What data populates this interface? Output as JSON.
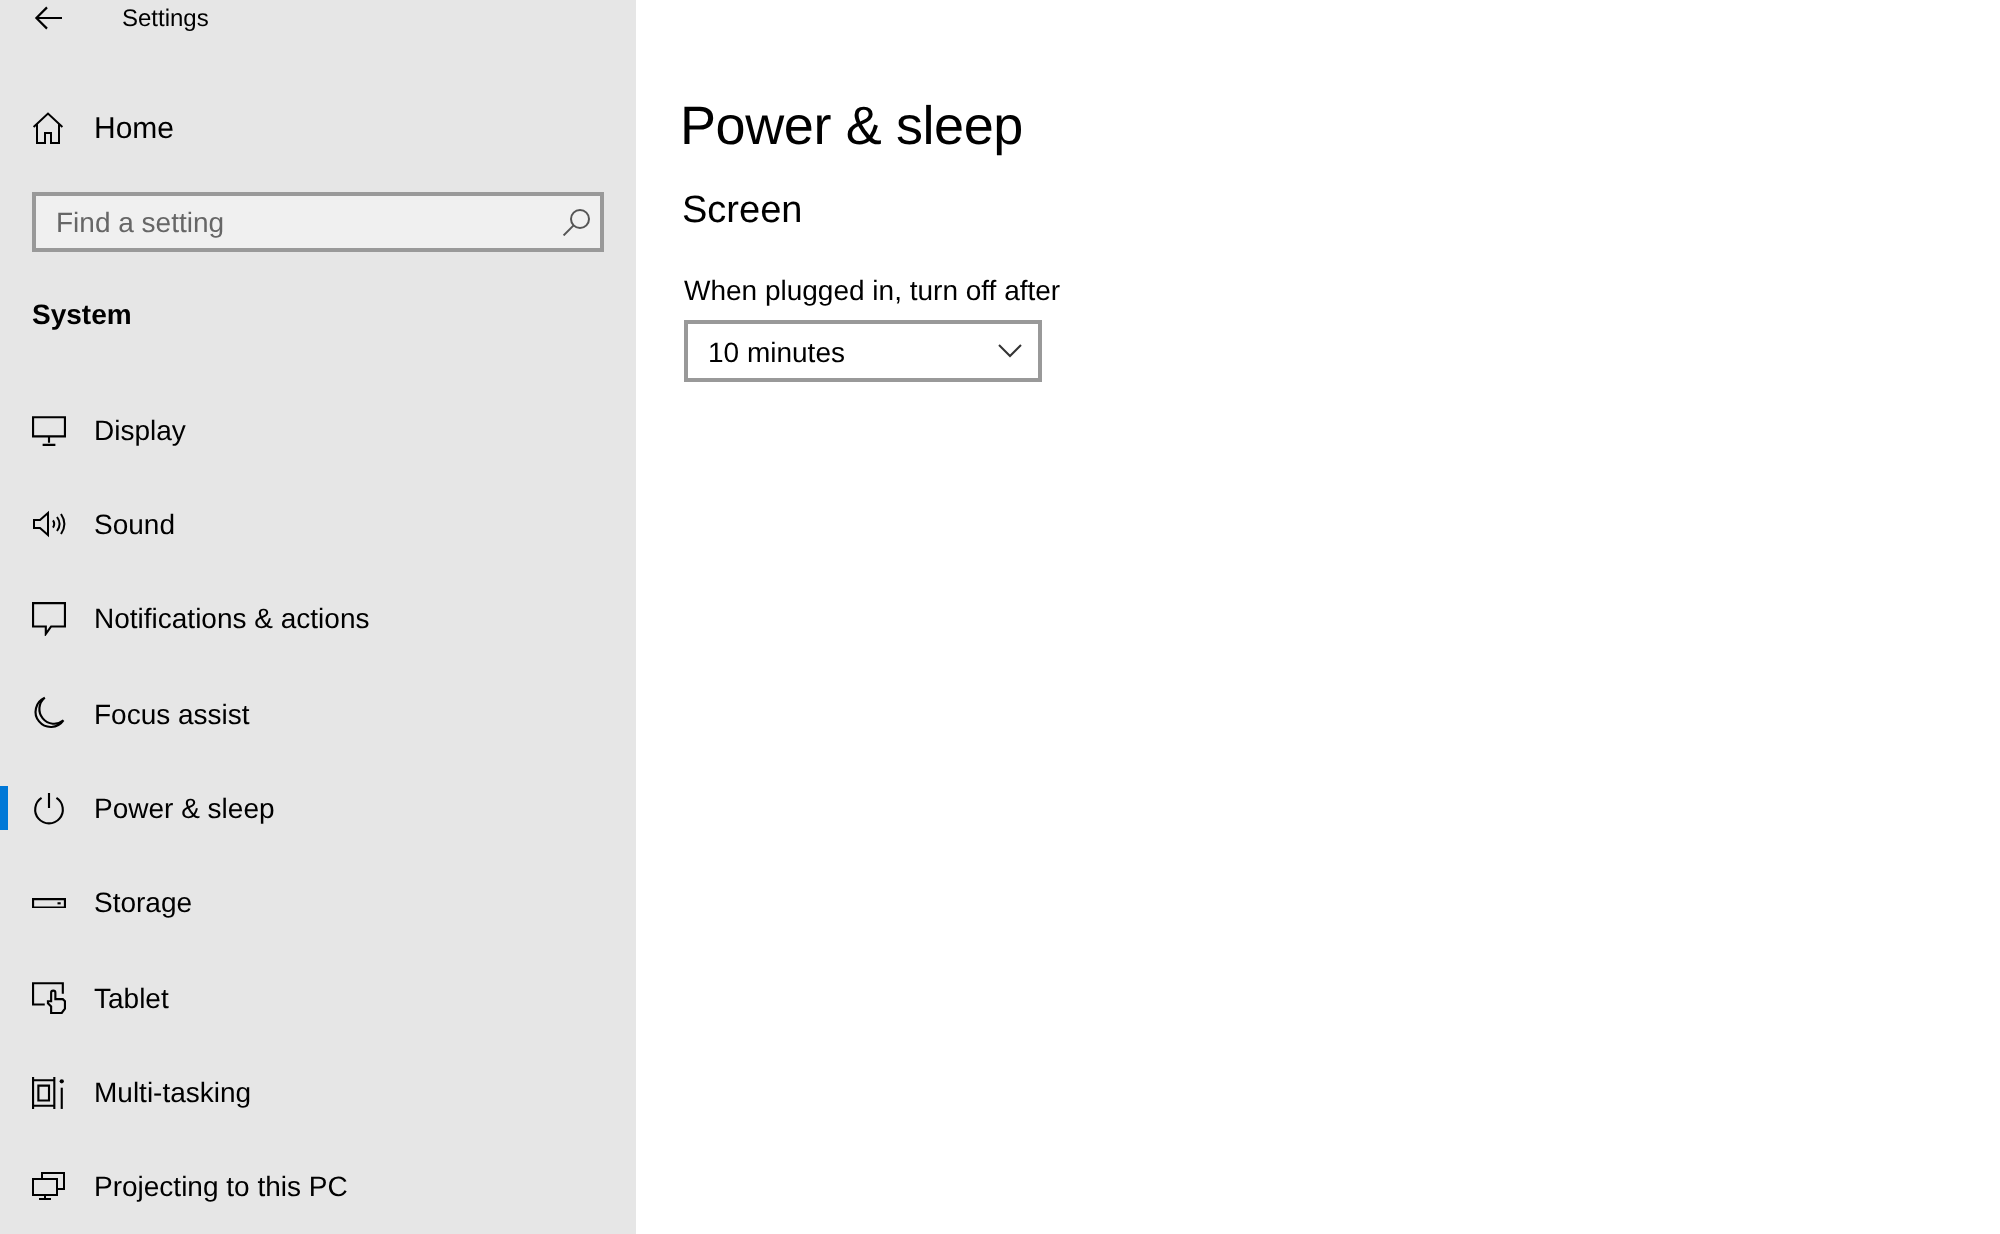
{
  "window": {
    "title": "Settings"
  },
  "sidebar": {
    "home": {
      "label": "Home"
    },
    "search": {
      "placeholder": "Find a setting"
    },
    "section": "System",
    "items": [
      {
        "label": "Display",
        "selected": false
      },
      {
        "label": "Sound",
        "selected": false
      },
      {
        "label": "Notifications & actions",
        "selected": false
      },
      {
        "label": "Focus assist",
        "selected": false
      },
      {
        "label": "Power & sleep",
        "selected": true
      },
      {
        "label": "Storage",
        "selected": false
      },
      {
        "label": "Tablet",
        "selected": false
      },
      {
        "label": "Multi-tasking",
        "selected": false
      },
      {
        "label": "Projecting to this PC",
        "selected": false
      }
    ]
  },
  "main": {
    "title": "Power & sleep",
    "section": "Screen",
    "setting": {
      "label": "When plugged in, turn off after",
      "value": "10 minutes"
    }
  }
}
